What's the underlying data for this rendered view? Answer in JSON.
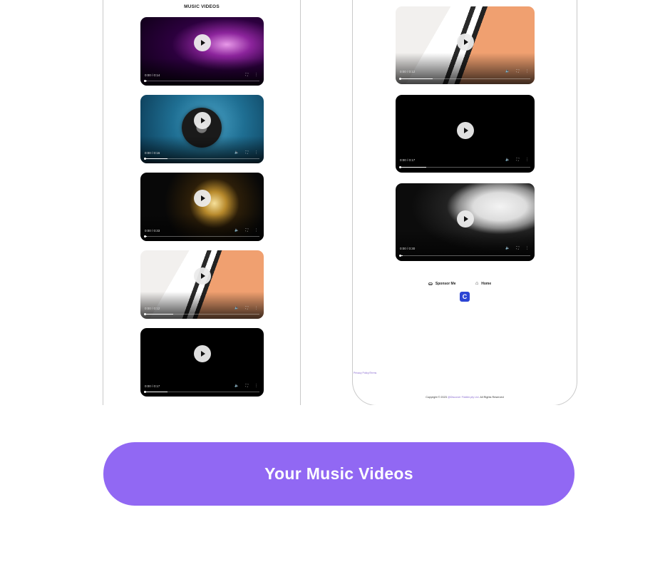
{
  "left_phone": {
    "section_title": "MUSIC VIDEOS",
    "videos": [
      {
        "time": "0:00 / 0:14",
        "progress": 0.02,
        "thumbnail": "concert-lights"
      },
      {
        "time": "0:00 / 0:16",
        "progress": 0.2,
        "thumbnail": "vinyl-player-blue"
      },
      {
        "time": "0:00 / 0:33",
        "progress": 0.02,
        "thumbnail": "rain-bokeh"
      },
      {
        "time": "0:00 / 0:12",
        "progress": 0.25,
        "thumbnail": "piano"
      },
      {
        "time": "0:00 / 0:17",
        "progress": 0.2,
        "thumbnail": "black"
      }
    ]
  },
  "right_phone": {
    "videos": [
      {
        "time": "0:00 / 0:12",
        "progress": 0.25,
        "thumbnail": "piano"
      },
      {
        "time": "0:00 / 0:17",
        "progress": 0.2,
        "thumbnail": "black"
      },
      {
        "time": "0:00 / 0:30",
        "progress": 0.02,
        "thumbnail": "vinyl-record"
      }
    ],
    "nav": {
      "sponsor_label": "Sponsor Me",
      "sponsor_icon": "hand-coin-icon",
      "home_label": "Home",
      "home_icon": "home-icon"
    },
    "logo_icon": "brand-logo-icon",
    "tiny_link": "Privacy Policy/Terms",
    "copyright_prefix": "Copyright © 2023",
    "copyright_brand": "@Discover Fiddler.pty Ltd.",
    "copyright_suffix": "All Rights Reserved"
  },
  "cta": {
    "label": "Your Music Videos",
    "color": "#9168f3"
  }
}
